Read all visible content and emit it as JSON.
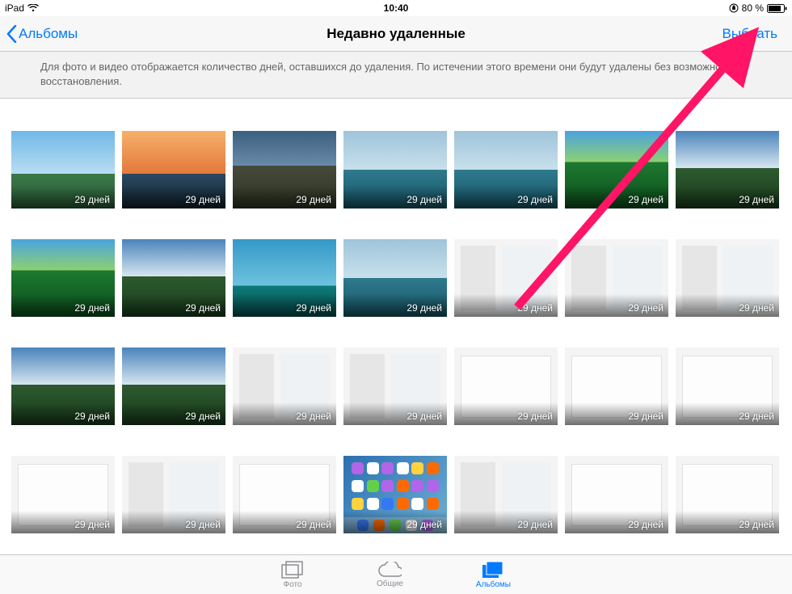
{
  "status": {
    "device": "iPad",
    "time": "10:40",
    "battery_pct": "80 %"
  },
  "nav": {
    "back_label": "Альбомы",
    "title": "Недавно удаленные",
    "select_label": "Выбрать"
  },
  "info": {
    "text": "Для фото и видео отображается количество дней, оставшихся до удаления. По истечении этого времени они будут удалены без возможности восстановления."
  },
  "days_label": "29 дней",
  "thumbs": [
    {
      "variant": "sky"
    },
    {
      "variant": "pier"
    },
    {
      "variant": "mount"
    },
    {
      "variant": "lake"
    },
    {
      "variant": "lake"
    },
    {
      "variant": "green"
    },
    {
      "variant": "alps"
    },
    {
      "variant": "green"
    },
    {
      "variant": "alps"
    },
    {
      "variant": "turq"
    },
    {
      "variant": "lake"
    },
    {
      "variant": "shot"
    },
    {
      "variant": "shot"
    },
    {
      "variant": "shot"
    },
    {
      "variant": "alps"
    },
    {
      "variant": "alps"
    },
    {
      "variant": "shot"
    },
    {
      "variant": "shot"
    },
    {
      "variant": "shot2"
    },
    {
      "variant": "shot2"
    },
    {
      "variant": "shot2"
    },
    {
      "variant": "shot2"
    },
    {
      "variant": "shot"
    },
    {
      "variant": "shot2"
    },
    {
      "variant": "home"
    },
    {
      "variant": "shot"
    },
    {
      "variant": "shot2"
    },
    {
      "variant": "shot2"
    }
  ],
  "tabs": {
    "photos": "Фото",
    "shared": "Общие",
    "albums": "Альбомы"
  }
}
